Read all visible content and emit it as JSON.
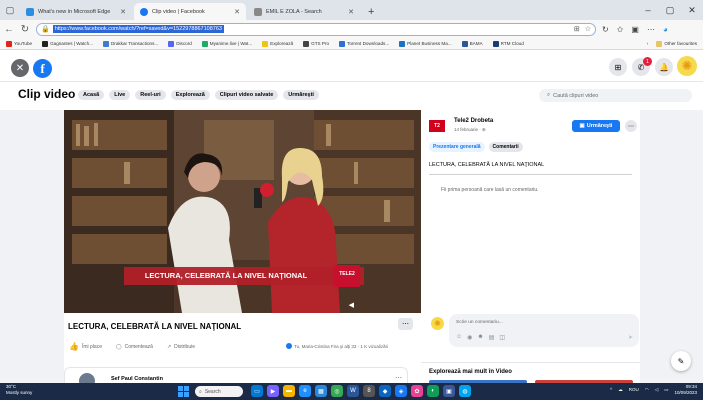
{
  "browser": {
    "tabs": [
      {
        "title": "What's new in Microsoft Edge",
        "icon": "edge-tab-icon",
        "color": "#2d8ee0"
      },
      {
        "title": "Clip video | Facebook",
        "icon": "facebook-tab-icon",
        "color": "#1877f2"
      },
      {
        "title": "EMIL E ZOLA - Search",
        "icon": "bing-tab-icon",
        "color": "#888888"
      }
    ],
    "url": "https://www.facebook.com/watch/?ref=saved&v=1522978867108763",
    "bookmarks": [
      "YouTube",
      "Gagnantes | Watch...",
      "Drakkar Transactions...",
      "Discord",
      "Myanime.live | Wat...",
      "Explorează",
      "GTS Pro",
      "Torrent Downloads...",
      "Planet Business Ma...",
      "BAMA",
      "RTM Cloud"
    ],
    "bookmarks_right": "Other favourites"
  },
  "fb": {
    "page_heading": "Clip video",
    "nav_chips": [
      "Acasă",
      "Live",
      "Reel-uri",
      "Explorează",
      "Clipuri video salvate",
      "Urmăreşti"
    ],
    "search_placeholder": "Caută clipuri video",
    "notification_count": "1"
  },
  "video": {
    "caption": "LECTURA, CELEBRATĂ LA NIVEL NAŢIONAL",
    "logo_text": "TELE2",
    "title": "LECTURA, CELEBRATĂ LA NIVEL NAŢIONAL",
    "actions": [
      "Îmi place",
      "Comentează",
      "Distribuie"
    ],
    "reactions": "Tu, Maria-Cristina Fira şi alţi 33 · 1 K vizualizări"
  },
  "next_post": {
    "author": "Sef Paul Constantin"
  },
  "side": {
    "page_name": "Tele2 Drobeta",
    "date": "14 februarie · ⊕",
    "follow": "Urmăreşti",
    "tabs": [
      "Prezentare generală",
      "Comentarii"
    ],
    "description": "LECTURA, CELEBRATĂ LA NIVEL NAŢIONAL",
    "first_comment": "Fii prima persoană care lasă un comentariu.",
    "comment_placeholder": "Scrie un comentariu...",
    "explore_title": "Explorează mai mult în Video"
  },
  "taskbar": {
    "weather_temp": "30°C",
    "weather_desc": "Mostly sunny",
    "search": "Search",
    "lang": "ROU",
    "time": "09:34",
    "date": "10/09/2023"
  }
}
